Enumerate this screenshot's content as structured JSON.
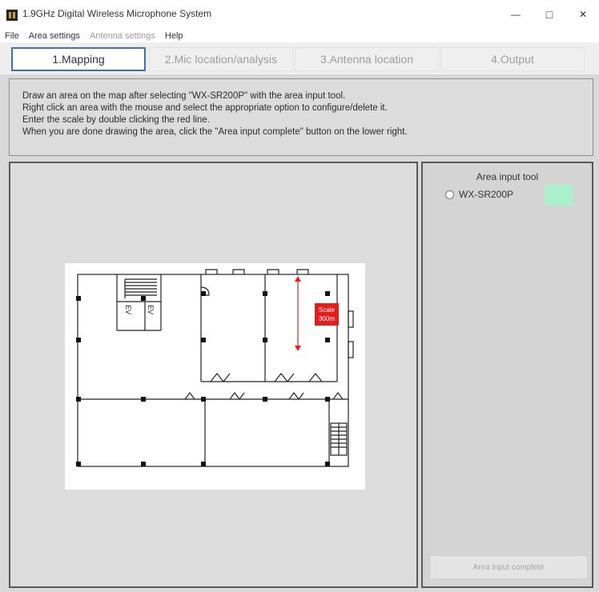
{
  "window": {
    "title": "1.9GHz Digital Wireless Microphone System",
    "minimize_glyph": "—",
    "maximize_glyph": "□",
    "close_glyph": "✕"
  },
  "menu": {
    "items": [
      {
        "label": "File",
        "enabled": true
      },
      {
        "label": "Area settings",
        "enabled": true
      },
      {
        "label": "Antenna settings",
        "enabled": false
      },
      {
        "label": "Help",
        "enabled": true
      }
    ]
  },
  "tabs": [
    {
      "label": "1.Mapping",
      "active": true
    },
    {
      "label": "2.Mic location/analysis",
      "active": false
    },
    {
      "label": "3.Antenna location",
      "active": false
    },
    {
      "label": "4.Output",
      "active": false
    }
  ],
  "instructions": [
    "Draw an area on the map after selecting \"WX-SR200P\" with the area input tool.",
    "Right click an area with the mouse and select the appropriate option to configure/delete it.",
    "Enter the scale by double clicking the red line.",
    "When you are done drawing the area, click the \"Area input complete\" button on the lower right."
  ],
  "map": {
    "elevator_label": "EV",
    "scale_label_line1": "Scale",
    "scale_label_line2": "300m",
    "scale_color": "#e41e1e"
  },
  "tool": {
    "title": "Area input tool",
    "option_label": "WX-SR200P",
    "option_selected": false,
    "swatch_color": "#a9f0cc",
    "complete_button_label": "Area input complete",
    "complete_button_enabled": false
  },
  "colors": {
    "active_tab_border": "#3e6fb7",
    "panel_border": "#595959"
  }
}
